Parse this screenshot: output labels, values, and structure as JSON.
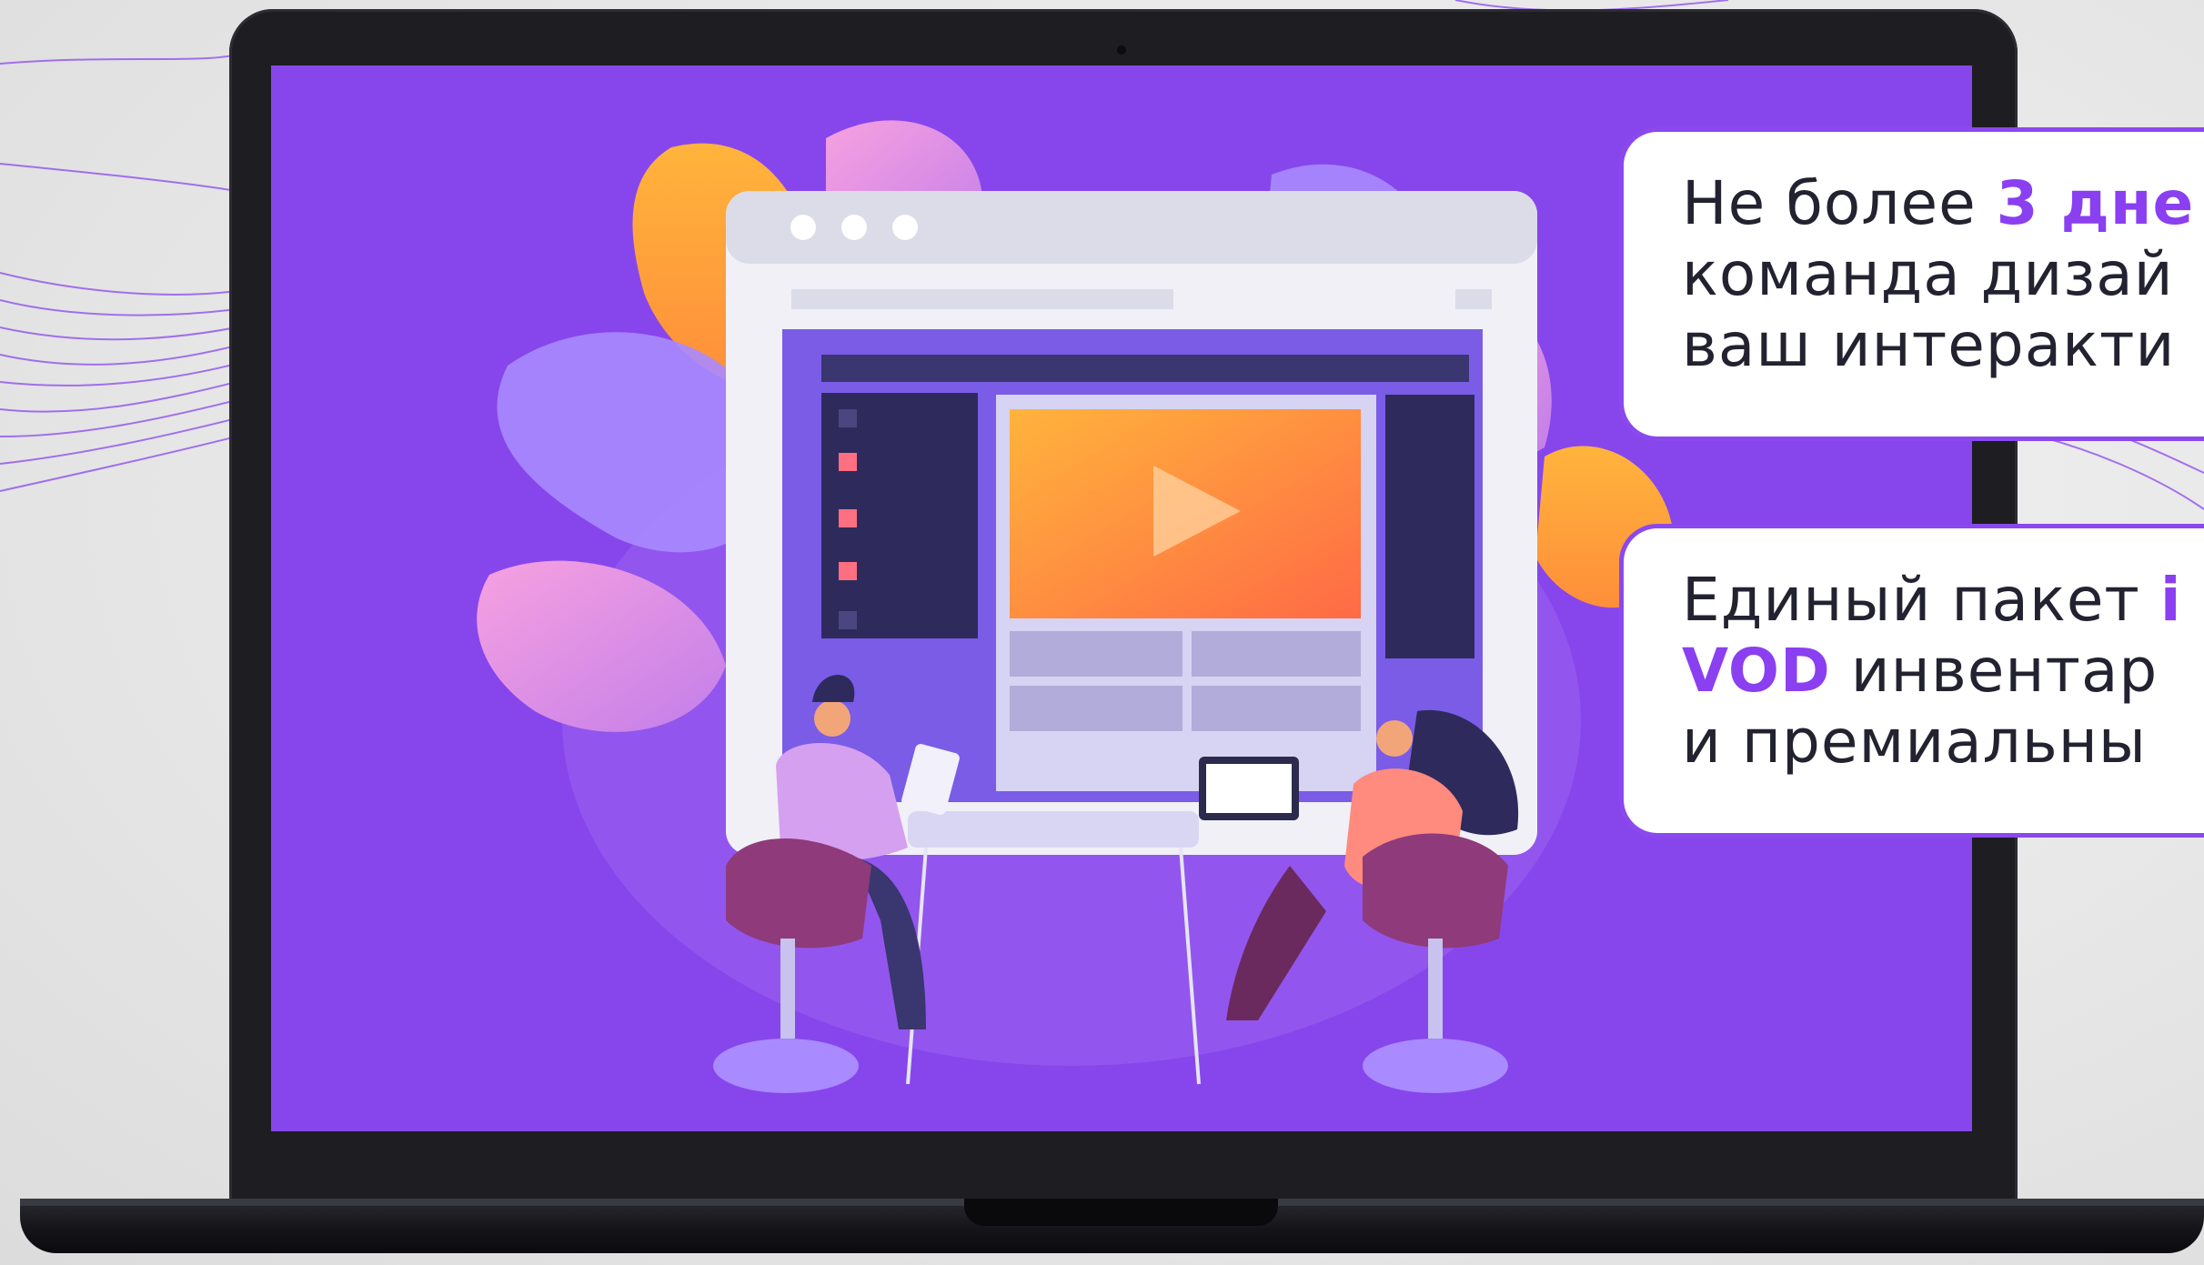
{
  "cards": [
    {
      "line1_prefix": "Не более ",
      "line1_highlight": "3 дне",
      "line2": "команда дизай",
      "line3": "ваш интеракти"
    },
    {
      "line1_prefix": "Единый пакет ",
      "line1_highlight": "i",
      "line2_highlight": "VOD",
      "line2_suffix": " инвентар",
      "line3": "и премиальны"
    }
  ],
  "colors": {
    "accent": "#8a3ff0",
    "screen_bg": "#8746ec",
    "card_border": "#8a48ee"
  },
  "icons": [
    "play-icon",
    "window-dots-icon"
  ]
}
